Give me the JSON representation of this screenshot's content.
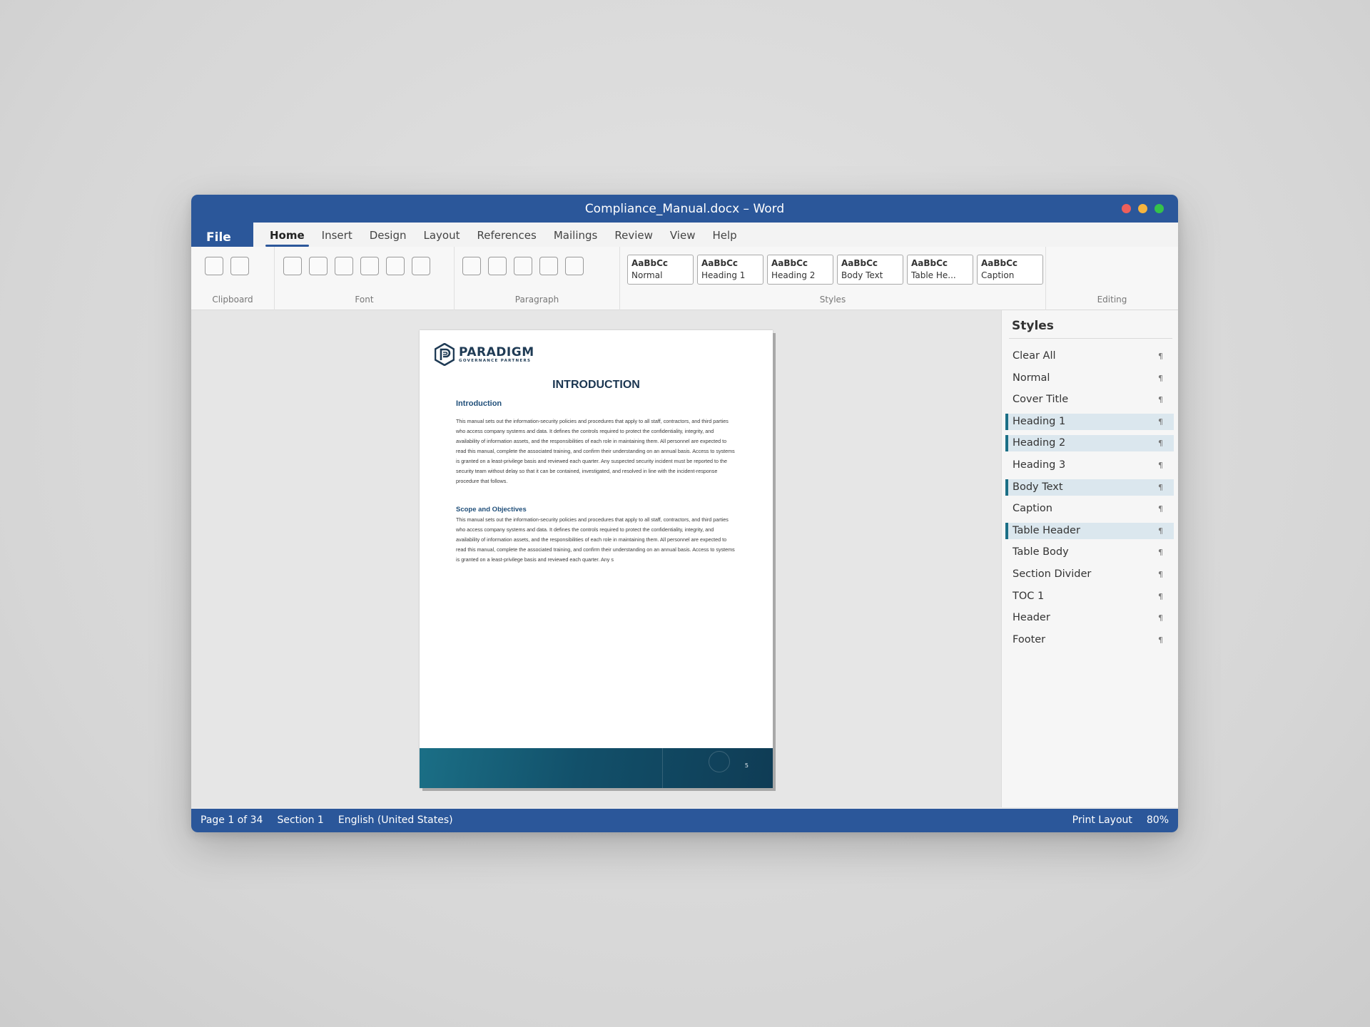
{
  "window": {
    "title": "Compliance_Manual.docx – Word",
    "traffic_colors": [
      "#ee5f5b",
      "#f6b43e",
      "#35c24a"
    ]
  },
  "ribbon_tabs": {
    "file": "File",
    "tabs": [
      "Home",
      "Insert",
      "Design",
      "Layout",
      "References",
      "Mailings",
      "Review",
      "View",
      "Help"
    ],
    "active": "Home"
  },
  "ribbon": {
    "groups": {
      "clipboard": "Clipboard",
      "font": "Font",
      "paragraph": "Paragraph",
      "styles": "Styles",
      "editing": "Editing"
    },
    "style_gallery": [
      {
        "sample": "AaBbCc",
        "name": "Normal"
      },
      {
        "sample": "AaBbCc",
        "name": "Heading 1"
      },
      {
        "sample": "AaBbCc",
        "name": "Heading 2"
      },
      {
        "sample": "AaBbCc",
        "name": "Body Text"
      },
      {
        "sample": "AaBbCc",
        "name": "Table He..."
      },
      {
        "sample": "AaBbCc",
        "name": "Caption"
      }
    ]
  },
  "document": {
    "logo_brand": "PARADIGM",
    "logo_tagline": "GOVERNANCE PARTNERS",
    "title": "INTRODUCTION",
    "section1_heading": "Introduction",
    "section1_body": "This manual sets out the information-security policies and procedures that apply to all staff, contractors, and third parties who access company systems and data. It defines the controls required to protect the confidentiality, integrity, and availability of information assets, and the responsibilities of each role in maintaining them. All personnel are expected to read this manual, complete the associated training, and confirm their understanding on an annual basis. Access to systems is granted on a least-privilege basis and reviewed each quarter. Any suspected security incident must be reported to the security team without delay so that it can be contained, investigated, and resolved in line with the incident-response procedure that follows.",
    "section2_heading": "Scope and Objectives",
    "section2_body": "This manual sets out the information-security policies and procedures that apply to all staff, contractors, and third parties who access company systems and data. It defines the controls required to protect the confidentiality, integrity, and availability of information assets, and the responsibilities of each role in maintaining them. All personnel are expected to read this manual, complete the associated training, and confirm their understanding on an annual basis. Access to systems is granted on a least-privilege basis and reviewed each quarter. Any s",
    "page_number": "5"
  },
  "styles_pane": {
    "title": "Styles",
    "items": [
      {
        "label": "Clear All",
        "highlighted": false
      },
      {
        "label": "Normal",
        "highlighted": false
      },
      {
        "label": "Cover Title",
        "highlighted": false
      },
      {
        "label": "Heading 1",
        "highlighted": true
      },
      {
        "label": "Heading 2",
        "highlighted": true
      },
      {
        "label": "Heading 3",
        "highlighted": false
      },
      {
        "label": "Body Text",
        "highlighted": true
      },
      {
        "label": "Caption",
        "highlighted": false
      },
      {
        "label": "Table Header",
        "highlighted": true
      },
      {
        "label": "Table Body",
        "highlighted": false
      },
      {
        "label": "Section Divider",
        "highlighted": false
      },
      {
        "label": "TOC 1",
        "highlighted": false
      },
      {
        "label": "Header",
        "highlighted": false
      },
      {
        "label": "Footer",
        "highlighted": false
      }
    ],
    "mark_glyph": "¶"
  },
  "statusbar": {
    "page": "Page 1 of 34",
    "section": "Section 1",
    "language": "English (United States)",
    "view": "Print Layout",
    "zoom": "80%"
  },
  "colors": {
    "accent": "#2b579a",
    "doc_heading": "#1f4e79",
    "highlight": "#dbe7ee",
    "highlight_bar": "#1b6f86"
  }
}
